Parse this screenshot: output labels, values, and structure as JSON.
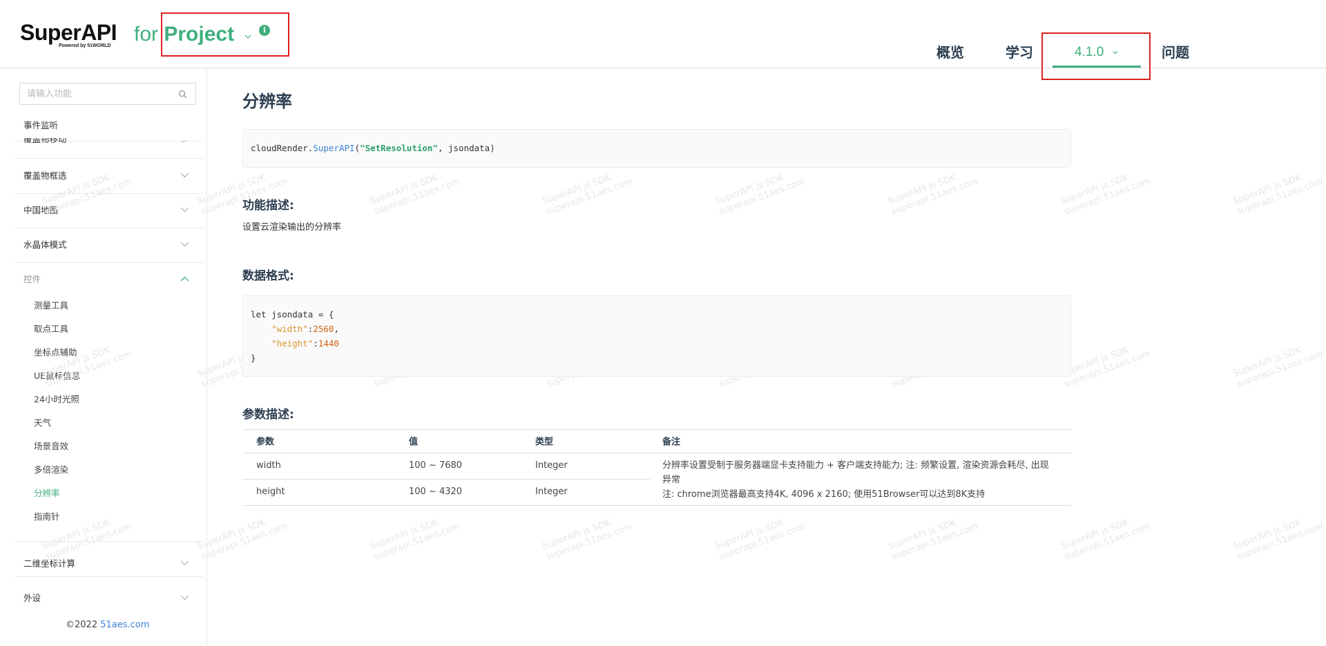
{
  "header": {
    "logo": {
      "text": "SuperAPI",
      "tagline": "Powered by 51WORLD"
    },
    "product": {
      "prefix": "for",
      "name": "Project"
    },
    "nav": [
      {
        "label": "概览"
      },
      {
        "label": "学习"
      },
      {
        "label": "4.1.0",
        "active": true
      },
      {
        "label": "问题"
      }
    ],
    "accent_color": "#3eaf7c",
    "highlight_color": "#e02020"
  },
  "sidebar": {
    "search_placeholder": "请输入功能",
    "event_item": "事件监听",
    "cut_item": "覆盖物移动",
    "groups": [
      {
        "label": "覆盖物框选"
      },
      {
        "label": "中国地图"
      },
      {
        "label": "水晶体模式"
      },
      {
        "label": "控件",
        "expanded": true
      }
    ],
    "sub_items": [
      {
        "label": "测量工具"
      },
      {
        "label": "取点工具"
      },
      {
        "label": "坐标点辅助"
      },
      {
        "label": "UE鼠标信息"
      },
      {
        "label": "24小时光照"
      },
      {
        "label": "天气"
      },
      {
        "label": "场景音效"
      },
      {
        "label": "多倍渲染"
      },
      {
        "label": "分辨率",
        "active": true
      },
      {
        "label": "指南针"
      }
    ],
    "bottom_groups": [
      {
        "label": "二维坐标计算"
      },
      {
        "label": "外设"
      }
    ],
    "copyright_prefix": "©2022 ",
    "copyright_link": "51aes.com"
  },
  "content": {
    "title": "分辨率",
    "call": {
      "obj": "cloudRender.",
      "method": "SuperAPI",
      "open": "(",
      "arg": "\"SetResolution\"",
      "rest": ", jsondata)"
    },
    "func_title": "功能描述:",
    "func_desc": "设置云渲染输出的分辨率",
    "format_title": "数据格式:",
    "code": {
      "line1": "let jsondata = {",
      "k1": "\"width\"",
      "v1": "2560",
      "k2": "\"height\"",
      "v2": "1440",
      "close": "}"
    },
    "params_title": "参数描述:",
    "table": {
      "headers": [
        "参数",
        "值",
        "类型",
        "备注"
      ],
      "rows": [
        {
          "param": "width",
          "value": "100 ~ 7680",
          "type": "Integer"
        },
        {
          "param": "height",
          "value": "100 ~ 4320",
          "type": "Integer"
        }
      ],
      "note_line1": "分辨率设置受制于服务器端显卡支持能力 + 客户端支持能力; 注: 频繁设置, 渲染资源会耗尽, 出现异常",
      "note_line2": "注: chrome浏览器最高支持4K, 4096 x 2160; 使用51Browser可以达到8K支持"
    }
  },
  "watermark": {
    "line1": "SuperAPI js SDK",
    "line2": "superapi.51aes.com"
  }
}
